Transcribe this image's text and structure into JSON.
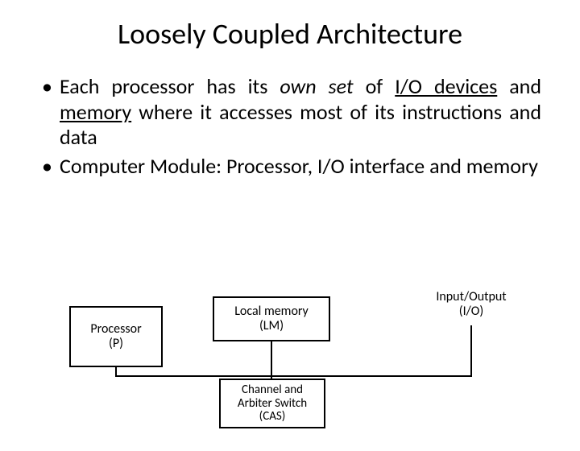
{
  "title": "Loosely Coupled Architecture",
  "bullets": [
    {
      "pre": "Each processor has its ",
      "em": "own set",
      "mid1": " of ",
      "u1": "I/O devices",
      "mid2": " and ",
      "u2": "memory",
      "post": " where it accesses most of its instructions and data"
    },
    {
      "text": "Computer Module: Processor, I/O interface and memory"
    }
  ],
  "diagram": {
    "processor": {
      "l1": "Processor",
      "l2": "(P)"
    },
    "lm": {
      "l1": "Local memory",
      "l2": "(LM)"
    },
    "io": {
      "l1": "Input/Output",
      "l2": "(I/O)"
    },
    "cas": {
      "l1": "Channel and",
      "l2": "Arbiter Switch",
      "l3": "(CAS)"
    }
  }
}
